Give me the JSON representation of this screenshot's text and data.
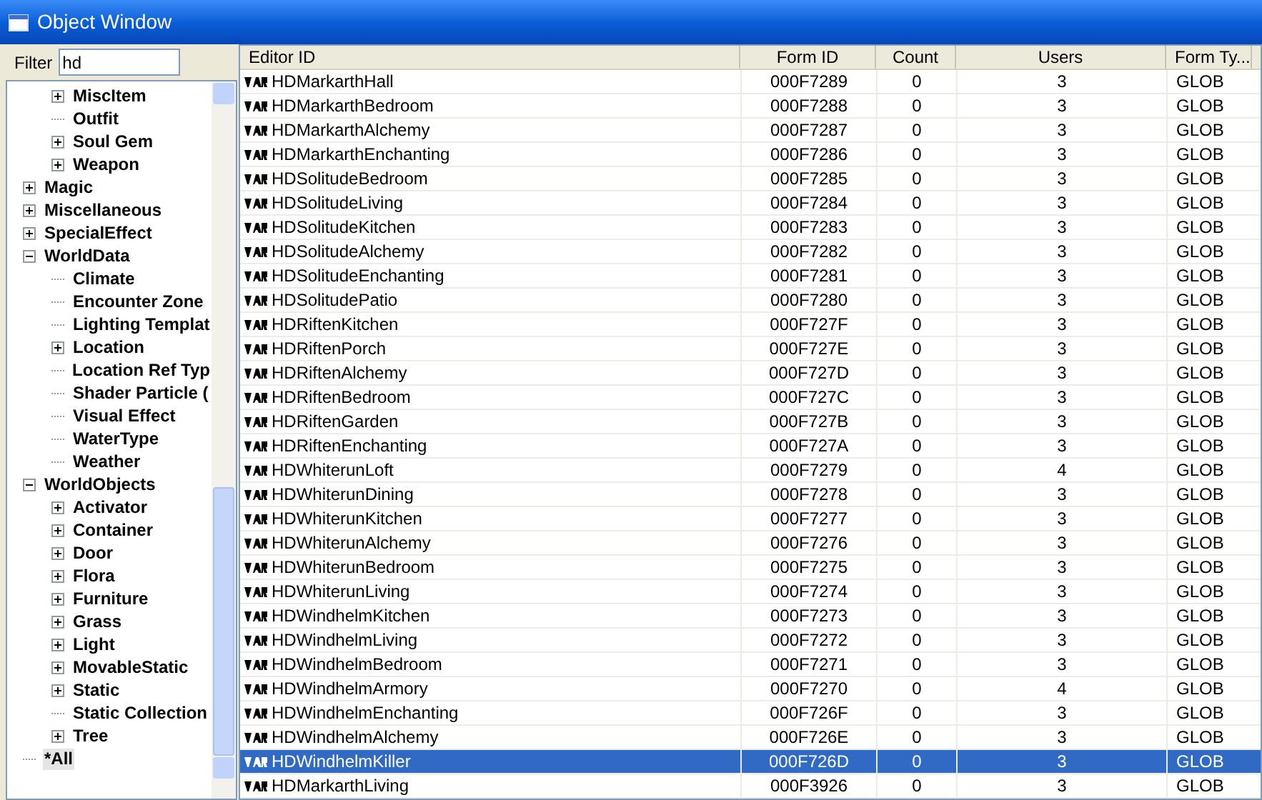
{
  "window": {
    "title": "Object Window"
  },
  "filter": {
    "label": "Filter",
    "value": "hd"
  },
  "tree": [
    {
      "children": [
        {
          "label": "MiscItem",
          "expandable": true,
          "expanded": false,
          "selected": false
        },
        {
          "label": "Outfit",
          "expandable": false,
          "selected": false
        },
        {
          "label": "Soul Gem",
          "expandable": true,
          "expanded": false,
          "selected": false
        },
        {
          "label": "Weapon",
          "expandable": true,
          "expanded": false,
          "selected": false
        }
      ]
    },
    {
      "label": "Magic",
      "expandable": true,
      "expanded": false,
      "selected": false
    },
    {
      "label": "Miscellaneous",
      "expandable": true,
      "expanded": false,
      "selected": false
    },
    {
      "label": "SpecialEffect",
      "expandable": true,
      "expanded": false,
      "selected": false
    },
    {
      "label": "WorldData",
      "expandable": true,
      "expanded": true,
      "selected": false,
      "children": [
        {
          "label": "Climate",
          "expandable": false,
          "selected": false
        },
        {
          "label": "Encounter Zone",
          "expandable": false,
          "selected": false
        },
        {
          "label": "Lighting Templat",
          "expandable": false,
          "selected": false
        },
        {
          "label": "Location",
          "expandable": true,
          "expanded": false,
          "selected": false
        },
        {
          "label": "Location Ref Typ",
          "expandable": false,
          "selected": false
        },
        {
          "label": "Shader Particle (",
          "expandable": false,
          "selected": false
        },
        {
          "label": "Visual Effect",
          "expandable": false,
          "selected": false
        },
        {
          "label": "WaterType",
          "expandable": false,
          "selected": false
        },
        {
          "label": "Weather",
          "expandable": false,
          "selected": false
        }
      ]
    },
    {
      "label": "WorldObjects",
      "expandable": true,
      "expanded": true,
      "selected": false,
      "children": [
        {
          "label": "Activator",
          "expandable": true,
          "expanded": false,
          "selected": false
        },
        {
          "label": "Container",
          "expandable": true,
          "expanded": false,
          "selected": false
        },
        {
          "label": "Door",
          "expandable": true,
          "expanded": false,
          "selected": false
        },
        {
          "label": "Flora",
          "expandable": true,
          "expanded": false,
          "selected": false
        },
        {
          "label": "Furniture",
          "expandable": true,
          "expanded": false,
          "selected": false
        },
        {
          "label": "Grass",
          "expandable": true,
          "expanded": false,
          "selected": false
        },
        {
          "label": "Light",
          "expandable": true,
          "expanded": false,
          "selected": false
        },
        {
          "label": "MovableStatic",
          "expandable": true,
          "expanded": false,
          "selected": false
        },
        {
          "label": "Static",
          "expandable": true,
          "expanded": false,
          "selected": false
        },
        {
          "label": "Static Collection",
          "expandable": false,
          "selected": false
        },
        {
          "label": "Tree",
          "expandable": true,
          "expanded": false,
          "selected": false
        }
      ]
    },
    {
      "label": "*All",
      "expandable": false,
      "selected": true
    }
  ],
  "table": {
    "columns": [
      "Editor ID",
      "Form ID",
      "Count",
      "Users",
      "Form Ty..."
    ],
    "rows": [
      {
        "cells": [
          "HDMarkarthHall",
          "000F7289",
          "0",
          "3",
          "GLOB"
        ],
        "selected": false
      },
      {
        "cells": [
          "HDMarkarthBedroom",
          "000F7288",
          "0",
          "3",
          "GLOB"
        ],
        "selected": false
      },
      {
        "cells": [
          "HDMarkarthAlchemy",
          "000F7287",
          "0",
          "3",
          "GLOB"
        ],
        "selected": false
      },
      {
        "cells": [
          "HDMarkarthEnchanting",
          "000F7286",
          "0",
          "3",
          "GLOB"
        ],
        "selected": false
      },
      {
        "cells": [
          "HDSolitudeBedroom",
          "000F7285",
          "0",
          "3",
          "GLOB"
        ],
        "selected": false
      },
      {
        "cells": [
          "HDSolitudeLiving",
          "000F7284",
          "0",
          "3",
          "GLOB"
        ],
        "selected": false
      },
      {
        "cells": [
          "HDSolitudeKitchen",
          "000F7283",
          "0",
          "3",
          "GLOB"
        ],
        "selected": false
      },
      {
        "cells": [
          "HDSolitudeAlchemy",
          "000F7282",
          "0",
          "3",
          "GLOB"
        ],
        "selected": false
      },
      {
        "cells": [
          "HDSolitudeEnchanting",
          "000F7281",
          "0",
          "3",
          "GLOB"
        ],
        "selected": false
      },
      {
        "cells": [
          "HDSolitudePatio",
          "000F7280",
          "0",
          "3",
          "GLOB"
        ],
        "selected": false
      },
      {
        "cells": [
          "HDRiftenKitchen",
          "000F727F",
          "0",
          "3",
          "GLOB"
        ],
        "selected": false
      },
      {
        "cells": [
          "HDRiftenPorch",
          "000F727E",
          "0",
          "3",
          "GLOB"
        ],
        "selected": false
      },
      {
        "cells": [
          "HDRiftenAlchemy",
          "000F727D",
          "0",
          "3",
          "GLOB"
        ],
        "selected": false
      },
      {
        "cells": [
          "HDRiftenBedroom",
          "000F727C",
          "0",
          "3",
          "GLOB"
        ],
        "selected": false
      },
      {
        "cells": [
          "HDRiftenGarden",
          "000F727B",
          "0",
          "3",
          "GLOB"
        ],
        "selected": false
      },
      {
        "cells": [
          "HDRiftenEnchanting",
          "000F727A",
          "0",
          "3",
          "GLOB"
        ],
        "selected": false
      },
      {
        "cells": [
          "HDWhiterunLoft",
          "000F7279",
          "0",
          "4",
          "GLOB"
        ],
        "selected": false
      },
      {
        "cells": [
          "HDWhiterunDining",
          "000F7278",
          "0",
          "3",
          "GLOB"
        ],
        "selected": false
      },
      {
        "cells": [
          "HDWhiterunKitchen",
          "000F7277",
          "0",
          "3",
          "GLOB"
        ],
        "selected": false
      },
      {
        "cells": [
          "HDWhiterunAlchemy",
          "000F7276",
          "0",
          "3",
          "GLOB"
        ],
        "selected": false
      },
      {
        "cells": [
          "HDWhiterunBedroom",
          "000F7275",
          "0",
          "3",
          "GLOB"
        ],
        "selected": false
      },
      {
        "cells": [
          "HDWhiterunLiving",
          "000F7274",
          "0",
          "3",
          "GLOB"
        ],
        "selected": false
      },
      {
        "cells": [
          "HDWindhelmKitchen",
          "000F7273",
          "0",
          "3",
          "GLOB"
        ],
        "selected": false
      },
      {
        "cells": [
          "HDWindhelmLiving",
          "000F7272",
          "0",
          "3",
          "GLOB"
        ],
        "selected": false
      },
      {
        "cells": [
          "HDWindhelmBedroom",
          "000F7271",
          "0",
          "3",
          "GLOB"
        ],
        "selected": false
      },
      {
        "cells": [
          "HDWindhelmArmory",
          "000F7270",
          "0",
          "4",
          "GLOB"
        ],
        "selected": false
      },
      {
        "cells": [
          "HDWindhelmEnchanting",
          "000F726F",
          "0",
          "3",
          "GLOB"
        ],
        "selected": false
      },
      {
        "cells": [
          "HDWindhelmAlchemy",
          "000F726E",
          "0",
          "3",
          "GLOB"
        ],
        "selected": false
      },
      {
        "cells": [
          "HDWindhelmKiller",
          "000F726D",
          "0",
          "3",
          "GLOB"
        ],
        "selected": true
      },
      {
        "cells": [
          "HDMarkarthLiving",
          "000F3926",
          "0",
          "3",
          "GLOB"
        ],
        "selected": false
      }
    ]
  }
}
